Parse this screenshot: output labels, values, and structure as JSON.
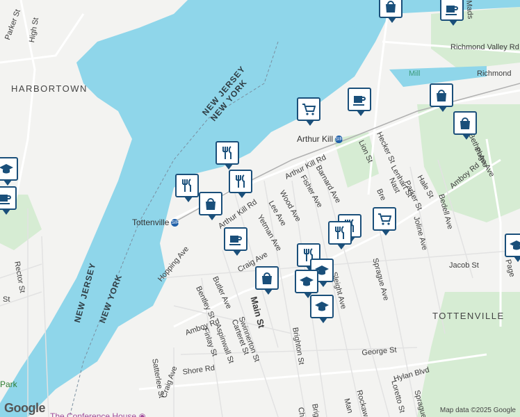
{
  "map": {
    "areas": [
      "HARBORTOWN",
      "TOTTENVILLE"
    ],
    "state_labels": [
      "NEW JERSEY",
      "NEW YORK",
      "NEW JERSEY",
      "NEW YORK"
    ],
    "stations": [
      {
        "name": "Tottenville",
        "badge": "SIR"
      },
      {
        "name": "Arthur Kill",
        "badge": "SIR"
      }
    ],
    "streets": [
      "Parker St",
      "High St",
      "Richmond Valley Rd",
      "Richmond",
      "Arthur Kill Rd",
      "Arthur Kill Rd",
      "Page Ave",
      "Amboy Rd",
      "Amboy Rd",
      "Lion St",
      "Hecker St",
      "Barnard Ave",
      "Fisher Ave",
      "Wood Ave",
      "Lee Ave",
      "Yetman Ave",
      "Craig Ave",
      "Butler Ave",
      "Bentley St",
      "Main St",
      "Hopping Ave",
      "Swinnerton St",
      "Carteret St",
      "Aspinwall St",
      "Finlay St",
      "Shore Rd",
      "Craig Ave",
      "Satterlee St",
      "Brighton St",
      "George St",
      "Hylan Blvd",
      "Sprague Ave",
      "Sprague Ave",
      "Sleight Ave",
      "Jacob St",
      "Joline Ave",
      "Bedell Ave",
      "Hale St",
      "Lenhart St",
      "Bethel Ave",
      "Parker St",
      "Nast",
      "Bre",
      "Mill",
      "Rockaw",
      "Loretto St",
      "Man",
      "Brig",
      "Ch",
      "Rector St",
      "Hi",
      "St",
      "Page",
      "Mads"
    ],
    "pois": [
      {
        "name": "The Conference House"
      },
      {
        "name": "Park"
      }
    ],
    "markers": [
      {
        "icon": "shopping-bag-icon"
      },
      {
        "icon": "coffee-cup-icon"
      },
      {
        "icon": "shopping-cart-icon"
      },
      {
        "icon": "coffee-cup-icon"
      },
      {
        "icon": "shopping-bag-icon"
      },
      {
        "icon": "shopping-bag-icon"
      },
      {
        "icon": "graduation-cap-icon"
      },
      {
        "icon": "coffee-cup-icon"
      },
      {
        "icon": "restaurant-icon"
      },
      {
        "icon": "restaurant-icon"
      },
      {
        "icon": "restaurant-icon"
      },
      {
        "icon": "shopping-bag-icon"
      },
      {
        "icon": "coffee-cup-icon"
      },
      {
        "icon": "shopping-bag-icon"
      },
      {
        "icon": "shopping-cart-icon"
      },
      {
        "icon": "restaurant-icon"
      },
      {
        "icon": "restaurant-icon"
      },
      {
        "icon": "restaurant-icon"
      },
      {
        "icon": "graduation-cap-icon"
      },
      {
        "icon": "graduation-cap-icon"
      },
      {
        "icon": "graduation-cap-icon"
      },
      {
        "icon": "graduation-cap-icon"
      }
    ],
    "logo": "Google",
    "attribution": "Map data ©2025 Google",
    "colors": {
      "water": "#8fd6ea",
      "park": "#cfe9cf",
      "land": "#f3f3f1",
      "road": "#ffffff",
      "pin": "#1a4f7a"
    }
  }
}
